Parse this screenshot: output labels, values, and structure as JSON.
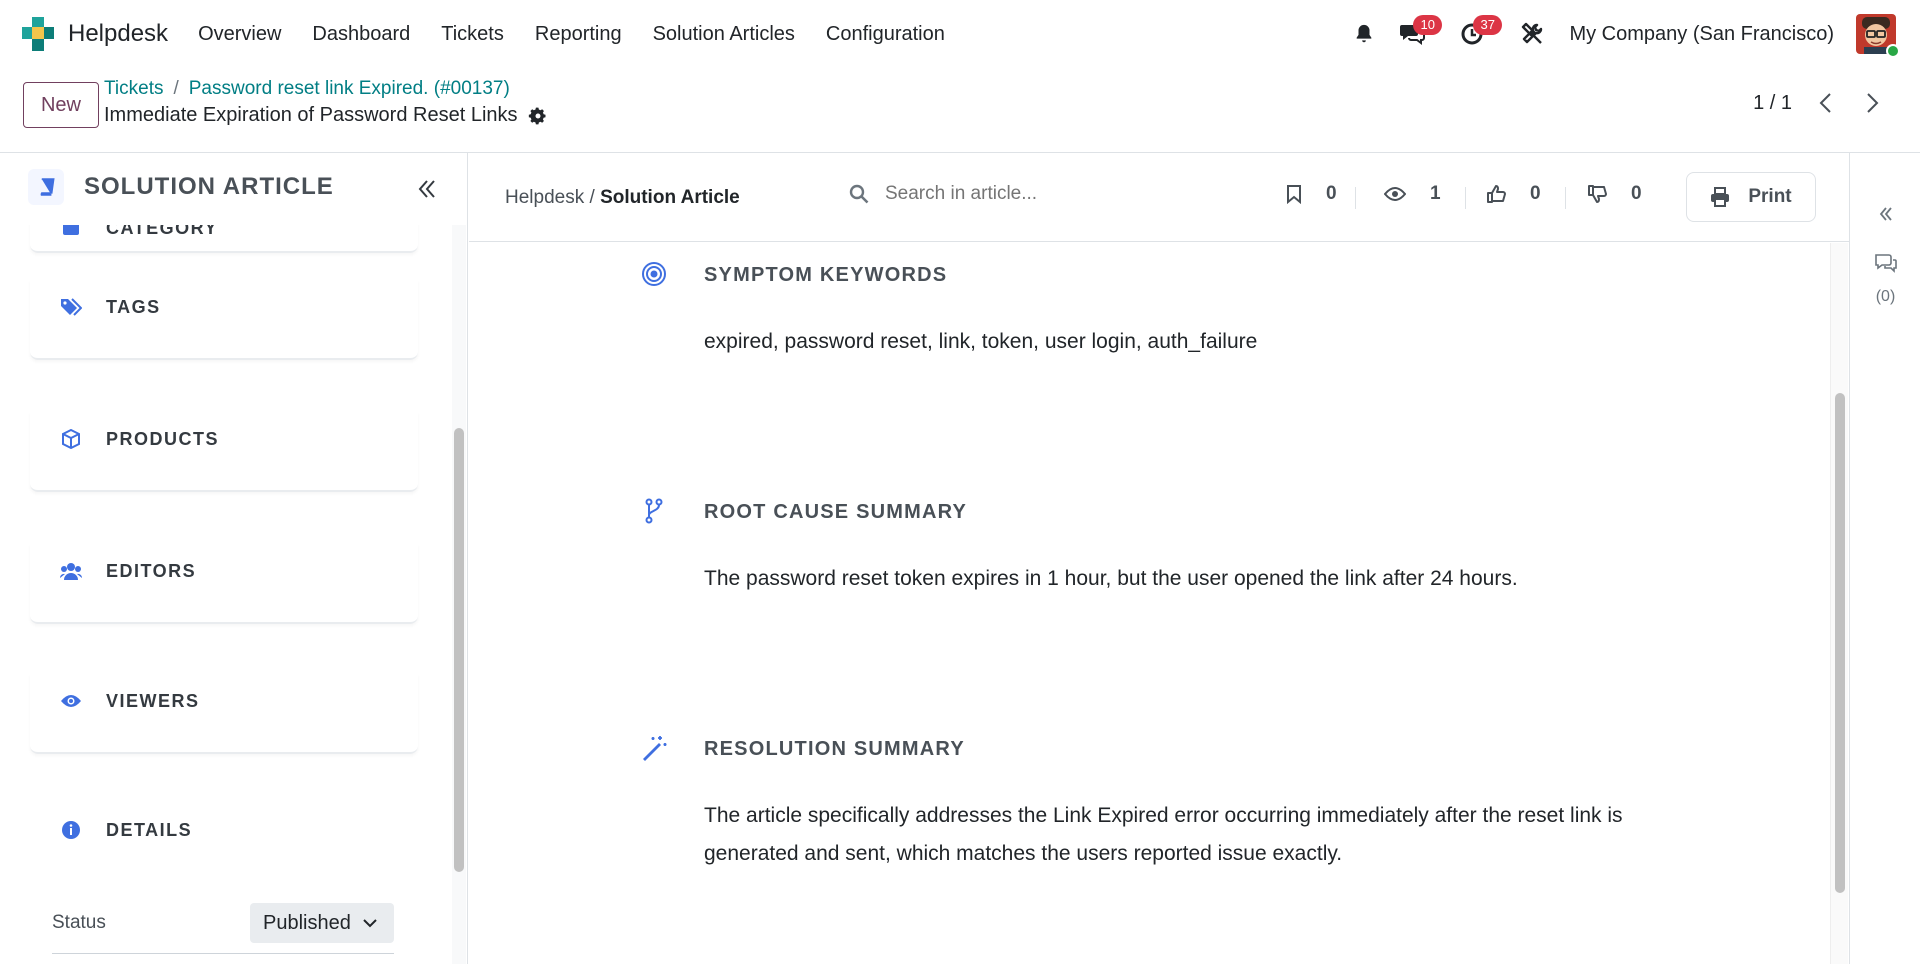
{
  "nav": {
    "brand": "Helpdesk",
    "menu": [
      "Overview",
      "Dashboard",
      "Tickets",
      "Reporting",
      "Solution Articles",
      "Configuration"
    ],
    "messages_badge": "10",
    "activities_badge": "37",
    "company": "My Company (San Francisco)"
  },
  "control": {
    "new_label": "New",
    "breadcrumb_root": "Tickets",
    "breadcrumb_sep": "/",
    "breadcrumb_parent": "Password reset link Expired. (#00137)",
    "record_title": "Immediate Expiration of Password Reset Links",
    "pager": "1 / 1"
  },
  "left_panel": {
    "title": "SOLUTION ARTICLE",
    "partial_label": "CATEGORY",
    "cards": [
      {
        "label": "TAGS",
        "icon": "tags-icon"
      },
      {
        "label": "PRODUCTS",
        "icon": "cube-icon"
      },
      {
        "label": "EDITORS",
        "icon": "users-icon"
      },
      {
        "label": "VIEWERS",
        "icon": "eye-icon"
      },
      {
        "label": "DETAILS",
        "icon": "info-icon"
      }
    ],
    "status_label": "Status",
    "status_value": "Published"
  },
  "article_header": {
    "breadcrumb_root": "Helpdesk",
    "breadcrumb_sep": " / ",
    "breadcrumb_current": "Solution Article",
    "search_placeholder": "Search in article...",
    "bookmarks": "0",
    "views": "1",
    "likes": "0",
    "dislikes": "0",
    "print_label": "Print"
  },
  "sections": [
    {
      "title": "SYMPTOM KEYWORDS",
      "icon": "target-icon",
      "body": "expired, password reset, link, token, user login, auth_failure"
    },
    {
      "title": "ROOT CAUSE SUMMARY",
      "icon": "branch-icon",
      "body": "The password reset token expires in 1 hour, but the user opened the link after 24 hours."
    },
    {
      "title": "RESOLUTION SUMMARY",
      "icon": "magic-wand-icon",
      "body": "The article specifically addresses the Link Expired error occurring immediately after the reset link is generated and sent, which matches the users reported issue exactly."
    }
  ],
  "rail": {
    "chatter_count": "(0)"
  },
  "colors": {
    "accent_teal": "#017e84",
    "brand_purple": "#71405f",
    "icon_blue": "#3f6fe0",
    "badge_red": "#dc3545"
  }
}
